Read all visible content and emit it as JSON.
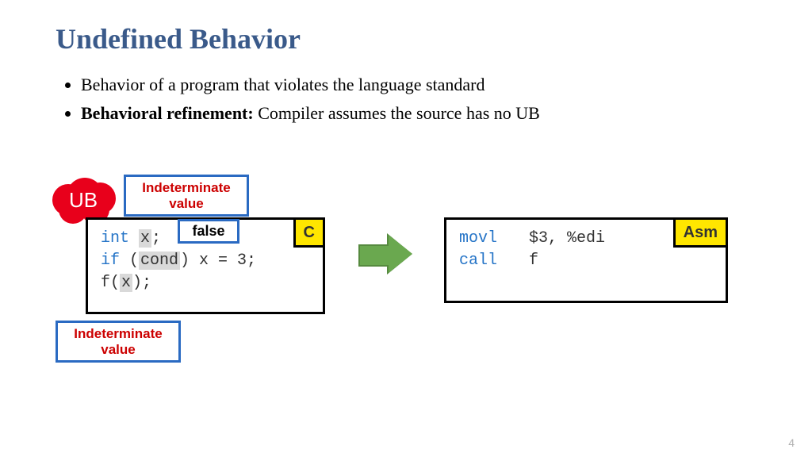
{
  "title": "Undefined Behavior",
  "bullets": {
    "b1": "Behavior of a program that violates the language standard",
    "b2_label": "Behavioral refinement:",
    "b2_rest": " Compiler assumes the source has no UB"
  },
  "ub_label": "UB",
  "callouts": {
    "indeterminate": "Indeterminate value",
    "false": "false"
  },
  "tags": {
    "c": "C",
    "asm": "Asm"
  },
  "c_code": {
    "kw_int": "int",
    "var_x": "x",
    "semi": ";",
    "kw_if": "if",
    "open_paren": " (",
    "cond": "cond",
    "close_assign": ") x = 3;",
    "call_prefix": "f(",
    "call_suffix": ");"
  },
  "asm_code": {
    "line1_op": "movl",
    "line1_args": "$3, %edi",
    "line2_op": "call",
    "line2_args": "f"
  },
  "page_number": "4"
}
